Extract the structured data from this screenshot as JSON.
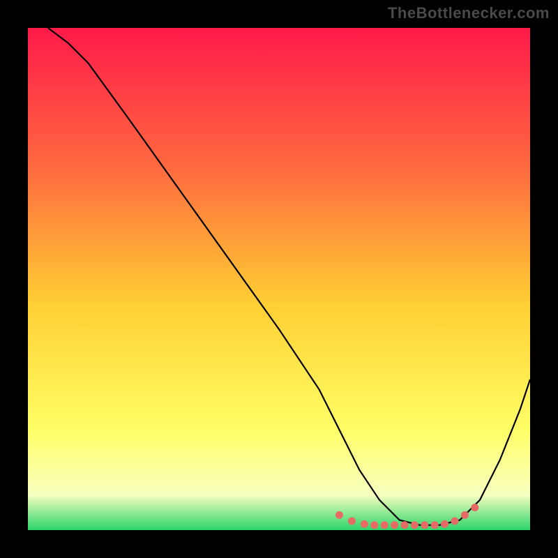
{
  "watermark": "TheBottlenecker.com",
  "colors": {
    "frame": "#000000",
    "curve": "#000000",
    "dots": "#e66b66",
    "gradient_top": "#ff1a4a",
    "gradient_upper": "#ff6a3f",
    "gradient_mid": "#ffcf33",
    "gradient_lower": "#ffff66",
    "gradient_pale": "#f7ffbf",
    "gradient_green": "#2bd56a"
  },
  "chart_data": {
    "type": "line",
    "title": "",
    "xlabel": "",
    "ylabel": "",
    "xlim": [
      0,
      100
    ],
    "ylim": [
      0,
      100
    ],
    "series": [
      {
        "name": "curve",
        "x": [
          4,
          8,
          12,
          20,
          30,
          40,
          50,
          58,
          62,
          66,
          70,
          74,
          78,
          82,
          86,
          90,
          94,
          98,
          100
        ],
        "y": [
          100,
          97,
          93,
          82,
          68,
          54,
          40,
          28,
          20,
          12,
          6,
          2,
          1,
          1,
          2,
          6,
          14,
          24,
          30
        ]
      }
    ],
    "markers": {
      "name": "bottom-dots",
      "x": [
        62,
        64.5,
        67,
        69,
        71,
        73,
        75,
        77,
        79,
        81,
        83,
        85,
        87,
        89
      ],
      "y": [
        3.0,
        1.8,
        1.2,
        1.0,
        1.0,
        1.0,
        1.0,
        1.0,
        1.0,
        1.0,
        1.2,
        1.8,
        3.0,
        4.5
      ]
    }
  }
}
